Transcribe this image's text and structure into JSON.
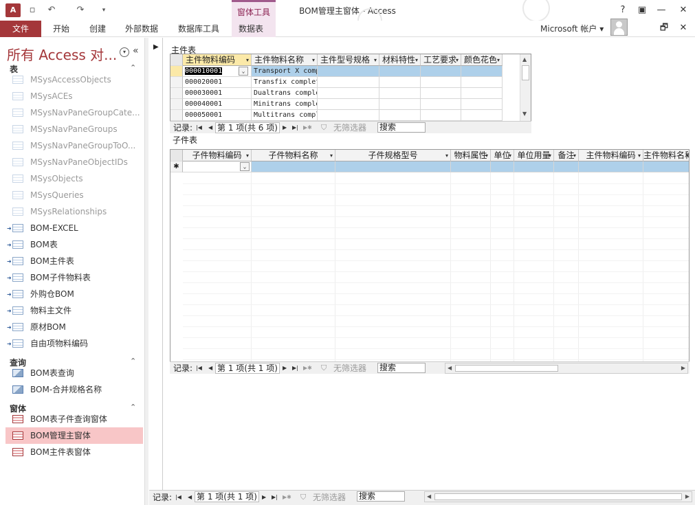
{
  "titlebar": {
    "app_logo": "A",
    "title": "BOM管理主窗体 - Access",
    "context_tools": "窗体工具",
    "qat": [
      "save-icon",
      "undo-icon",
      "redo-icon",
      "customize-icon"
    ],
    "window_buttons": [
      "?",
      "▣",
      "—",
      "☐",
      "✕"
    ]
  },
  "ribbon": {
    "file": "文件",
    "tabs": [
      "开始",
      "创建",
      "外部数据",
      "数据库工具",
      "数据表"
    ],
    "account": "Microsoft 帐户 ▾",
    "right_buttons": [
      "🗗",
      "✕"
    ]
  },
  "nav": {
    "title": "所有 Access 对...",
    "menu_glyph": "▾",
    "collapse_glyph": "«",
    "group_chevron": "⌃",
    "groups": [
      {
        "label": "表",
        "items": [
          {
            "label": "MSysAccessObjects",
            "kind": "sys"
          },
          {
            "label": "MSysACEs",
            "kind": "sys"
          },
          {
            "label": "MSysNavPaneGroupCate...",
            "kind": "sys"
          },
          {
            "label": "MSysNavPaneGroups",
            "kind": "sys"
          },
          {
            "label": "MSysNavPaneGroupToO...",
            "kind": "sys"
          },
          {
            "label": "MSysNavPaneObjectIDs",
            "kind": "sys"
          },
          {
            "label": "MSysObjects",
            "kind": "sys"
          },
          {
            "label": "MSysQueries",
            "kind": "sys"
          },
          {
            "label": "MSysRelationships",
            "kind": "sys"
          },
          {
            "label": "BOM-EXCEL",
            "kind": "link"
          },
          {
            "label": "BOM表",
            "kind": "link"
          },
          {
            "label": "BOM主件表",
            "kind": "link"
          },
          {
            "label": "BOM子件物料表",
            "kind": "link"
          },
          {
            "label": "外购仓BOM",
            "kind": "link"
          },
          {
            "label": "物料主文件",
            "kind": "link"
          },
          {
            "label": "原材BOM",
            "kind": "link"
          },
          {
            "label": "自由项物料编码",
            "kind": "link"
          }
        ]
      },
      {
        "label": "查询",
        "items": [
          {
            "label": "BOM表查询",
            "kind": "query"
          },
          {
            "label": "BOM-合并规格名称",
            "kind": "query"
          }
        ]
      },
      {
        "label": "窗体",
        "items": [
          {
            "label": "BOM表子件查询窗体",
            "kind": "form"
          },
          {
            "label": "BOM管理主窗体",
            "kind": "form",
            "selected": true
          },
          {
            "label": "BOM主件表窗体",
            "kind": "form"
          }
        ]
      }
    ]
  },
  "main_grid": {
    "label": "主件表",
    "columns": [
      "主件物料编码",
      "主件物料名称",
      "主件型号规格",
      "材料特性",
      "工艺要求",
      "颜色花色"
    ],
    "rows": [
      [
        "000010001",
        "Transport X complete",
        "",
        "",
        "",
        ""
      ],
      [
        "000020001",
        "Transfix complete",
        "",
        "",
        "",
        ""
      ],
      [
        "000030001",
        "Dualtrans complete",
        "",
        "",
        "",
        ""
      ],
      [
        "000040001",
        "Minitrans complete",
        "",
        "",
        "",
        ""
      ],
      [
        "000050001",
        "Multitrans complete",
        "",
        "",
        "",
        ""
      ]
    ],
    "navbar": {
      "label": "记录:",
      "record": "第 1 项(共 6 项)",
      "filter": "无筛选器",
      "search": "搜索"
    }
  },
  "sub_grid": {
    "label": "子件表",
    "columns": [
      "子件物料编码",
      "子件物料名称",
      "子件规格型号",
      "物料属性",
      "单位",
      "单位用量",
      "备注",
      "主件物料编码",
      "主件物料名称"
    ],
    "new_row_glyph": "✱",
    "navbar": {
      "label": "记录:",
      "record": "第 1 项(共 1 项)",
      "filter": "无筛选器",
      "search": "搜索"
    }
  },
  "form_navbar": {
    "label": "记录:",
    "record": "第 1 项(共 1 项)",
    "filter": "无筛选器",
    "search": "搜索"
  },
  "glyphs": {
    "first": "|◀",
    "prev": "◀",
    "next": "▶",
    "last": "▶|",
    "new": "▶✱",
    "funnel": "⛉",
    "dropdown": "▾",
    "combo": "⌄",
    "up": "▲",
    "down": "▼",
    "left": "◀",
    "right": "▶",
    "form_selector": "▶"
  },
  "colors": {
    "brand": "#a4373a",
    "selection": "#f8c6c7",
    "active_header": "#fbe9a8",
    "row_highlight": "#aed0ea"
  }
}
